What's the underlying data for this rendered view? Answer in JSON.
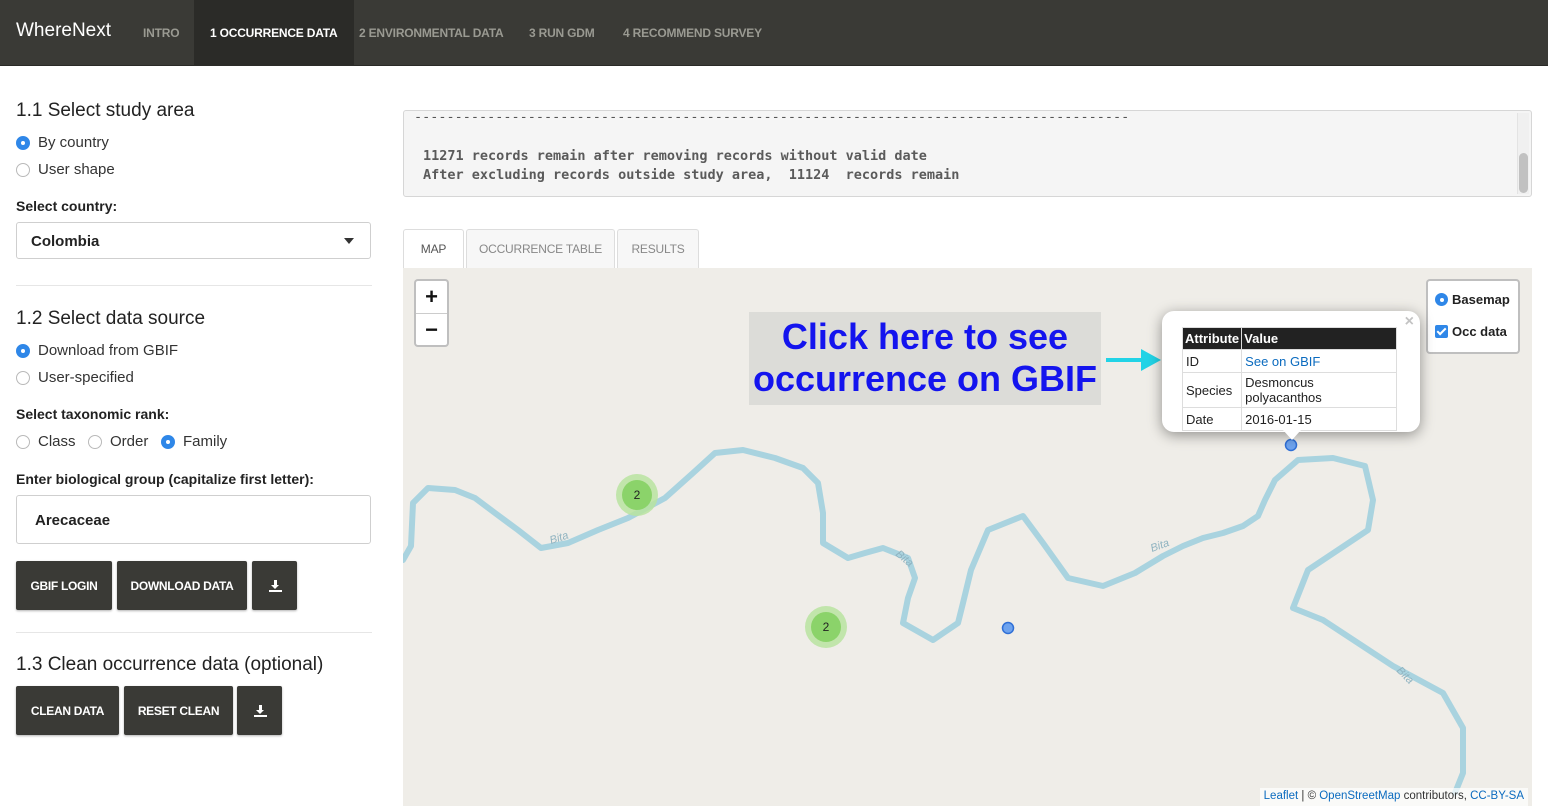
{
  "app": {
    "brand": "WhereNext"
  },
  "nav": {
    "tabs": [
      {
        "label": "INTRO"
      },
      {
        "label": "1 OCCURRENCE DATA"
      },
      {
        "label": "2 ENVIRONMENTAL DATA"
      },
      {
        "label": "3 RUN GDM"
      },
      {
        "label": "4 RECOMMEND SURVEY"
      }
    ]
  },
  "sidebar": {
    "study_area": {
      "title": "1.1 Select study area",
      "options": [
        "By country",
        "User shape"
      ],
      "selected": "By country",
      "country_label": "Select country:",
      "country_value": "Colombia"
    },
    "data_source": {
      "title": "1.2 Select data source",
      "options": [
        "Download from GBIF",
        "User-specified"
      ],
      "selected": "Download from GBIF",
      "rank_label": "Select taxonomic rank:",
      "ranks": [
        "Class",
        "Order",
        "Family"
      ],
      "rank_selected": "Family",
      "group_label": "Enter biological group (capitalize first letter):",
      "group_value": "Arecaceae",
      "buttons": {
        "gbif_login": "GBIF LOGIN",
        "download_data": "DOWNLOAD DATA"
      }
    },
    "clean": {
      "title": "1.3 Clean occurrence data (optional)",
      "buttons": {
        "clean_data": "CLEAN DATA",
        "reset_clean": "RESET CLEAN"
      }
    }
  },
  "console": {
    "separator": "----------------------------------------------------------------------------------------",
    "lines": [
      "11271 records remain after removing records without valid date",
      "After excluding records outside study area,  11124  records remain"
    ]
  },
  "output_tabs": [
    {
      "label": "MAP"
    },
    {
      "label": "OCCURRENCE TABLE"
    },
    {
      "label": "RESULTS"
    }
  ],
  "map": {
    "zoom_in": "+",
    "zoom_out": "−",
    "layers": [
      {
        "label": "Basemap",
        "type": "radio",
        "checked": true
      },
      {
        "label": "Occ data",
        "type": "checkbox",
        "checked": true
      }
    ],
    "annotation": "Click here to see occurrence on GBIF",
    "popup": {
      "close": "×",
      "headers": [
        "Attribute",
        "Value"
      ],
      "rows": [
        {
          "attr": "ID",
          "value": "See on GBIF",
          "link": true
        },
        {
          "attr": "Species",
          "value": "Desmoncus polyacanthos"
        },
        {
          "attr": "Date",
          "value": "2016-01-15"
        }
      ]
    },
    "clusters": [
      {
        "count": "2"
      },
      {
        "count": "2"
      }
    ],
    "river_label": "Bita",
    "attribution": {
      "leaflet": "Leaflet",
      "sep": " | © ",
      "osm": "OpenStreetMap",
      "contrib": " contributors, ",
      "license": "CC-BY-SA"
    },
    "colors": {
      "river": "#a9d3df",
      "cluster_fill": "#8bd36a",
      "marker": "#3a86e8",
      "annotation_text": "#1414ee",
      "arrow": "#22d3e6"
    }
  }
}
